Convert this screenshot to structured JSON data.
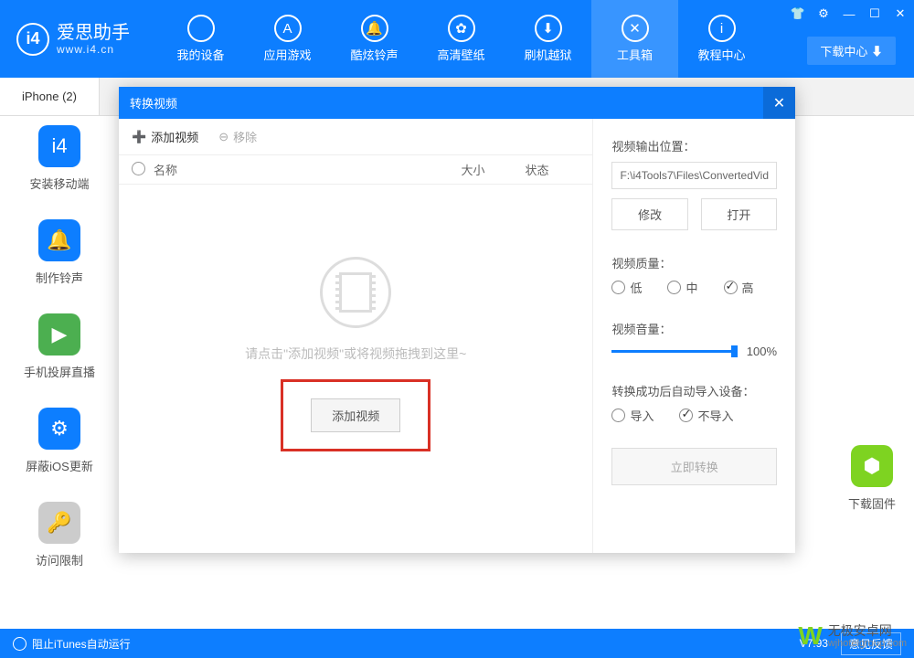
{
  "app": {
    "title": "爱思助手",
    "subtitle": "www.i4.cn",
    "logo": "i4"
  },
  "nav": {
    "items": [
      {
        "label": "我的设备",
        "glyph": ""
      },
      {
        "label": "应用游戏",
        "glyph": "A"
      },
      {
        "label": "酷炫铃声",
        "glyph": "🔔"
      },
      {
        "label": "高清壁纸",
        "glyph": "✿"
      },
      {
        "label": "刷机越狱",
        "glyph": "⬇"
      },
      {
        "label": "工具箱",
        "glyph": "✕"
      },
      {
        "label": "教程中心",
        "glyph": "i"
      }
    ]
  },
  "download_center": "下载中心 ⬇",
  "tab": {
    "label": "iPhone (2)"
  },
  "side": {
    "items": [
      {
        "label": "安装移动端"
      },
      {
        "label": "制作铃声"
      },
      {
        "label": "手机投屏直播"
      },
      {
        "label": "屏蔽iOS更新"
      },
      {
        "label": "访问限制"
      }
    ],
    "right_label": "下载固件"
  },
  "modal": {
    "title": "转换视频",
    "toolbar": {
      "add": "添加视频",
      "remove": "移除"
    },
    "columns": {
      "name": "名称",
      "size": "大小",
      "status": "状态"
    },
    "empty_text": "请点击\"添加视频\"或将视频拖拽到这里~",
    "add_button": "添加视频",
    "right": {
      "output_label": "视频输出位置：",
      "output_path": "F:\\i4Tools7\\Files\\ConvertedVid",
      "modify": "修改",
      "open": "打开",
      "quality_label": "视频质量：",
      "quality": {
        "low": "低",
        "mid": "中",
        "high": "高"
      },
      "volume_label": "视频音量：",
      "volume_value": "100%",
      "import_label": "转换成功后自动导入设备：",
      "import": {
        "yes": "导入",
        "no": "不导入"
      },
      "convert": "立即转换"
    }
  },
  "footer": {
    "itunes": "阻止iTunes自动运行",
    "version": "V7.93",
    "feedback": "意见反馈"
  },
  "watermark": {
    "title": "无极安卓网",
    "sub": "wjhotelgroup.com"
  }
}
